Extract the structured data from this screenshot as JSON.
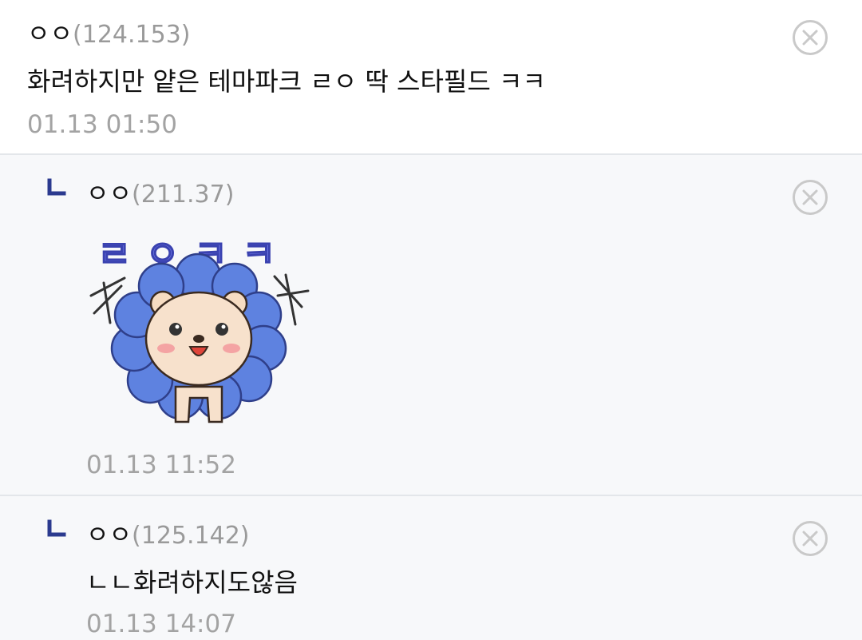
{
  "comments": [
    {
      "nickname": "ㅇㅇ",
      "ip": "(124.153)",
      "text": "화려하지만 얕은 테마파크 ㄹㅇ 딱 스타필드 ㅋㅋ",
      "date": "01.13 01:50",
      "delete_icon": "close-circle-icon"
    },
    {
      "nickname": "ㅇㅇ",
      "ip": "(211.37)",
      "sticker": {
        "text": "ㄹㅇㅋㅋ",
        "icon": "lion-sticker",
        "accent": "#5a66d8",
        "mane": "#4f74d6"
      },
      "date": "01.13 11:52",
      "delete_icon": "close-circle-icon",
      "reply_icon": "reply-arrow-icon"
    },
    {
      "nickname": "ㅇㅇ",
      "ip": "(125.142)",
      "text": "ㄴㄴ화려하지도않음",
      "date": "01.13 14:07",
      "delete_icon": "close-circle-icon",
      "reply_icon": "reply-arrow-icon"
    }
  ],
  "colors": {
    "reply_mark": "#2b3a8f",
    "divider": "#e3e6ea",
    "reply_bg": "#f7f8fa"
  }
}
